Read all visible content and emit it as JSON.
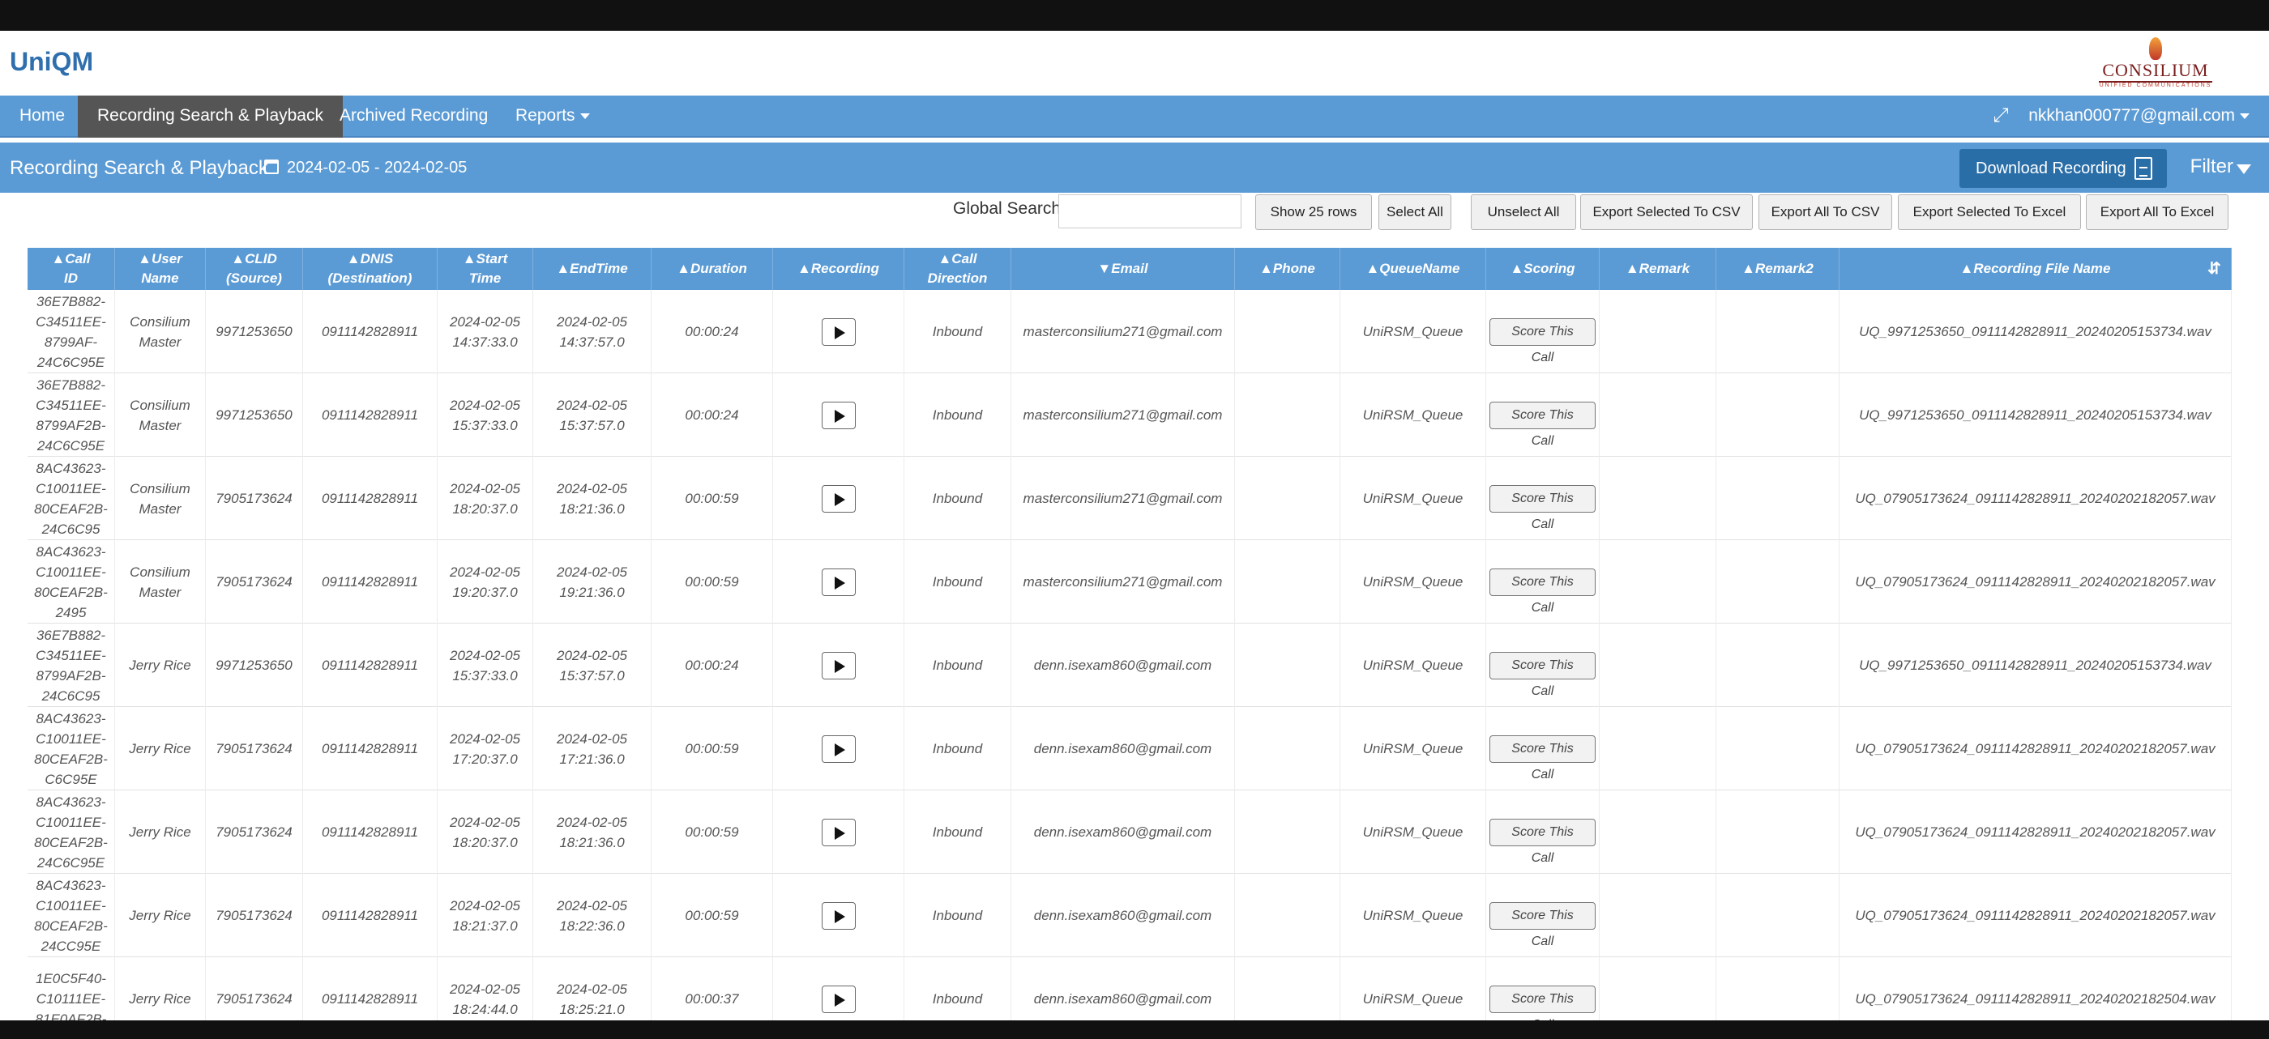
{
  "app": {
    "title": "UniQM",
    "logo_text": "CONSILIUM",
    "logo_subtext": "UNIFIED COMMUNICATIONS"
  },
  "nav": {
    "items": [
      {
        "label": "Home"
      },
      {
        "label": "Recording Search & Playback"
      },
      {
        "label": "Archived Recording"
      },
      {
        "label": "Reports"
      }
    ],
    "user": "nkkhan000777@gmail.com"
  },
  "page": {
    "title": "Recording Search & Playback",
    "date_range": "2024-02-05 - 2024-02-05",
    "download_label": "Download Recording",
    "filter_label": "Filter"
  },
  "toolbar": {
    "global_search_label": "Global Search",
    "global_search_value": "",
    "buttons": [
      "Show 25 rows",
      "Select All",
      "Unselect All",
      "Export Selected To CSV",
      "Export All To CSV",
      "Export Selected To Excel",
      "Export All To Excel"
    ]
  },
  "table": {
    "headers": [
      "▲Call\nID",
      "▲User\nName",
      "▲CLID\n(Source)",
      "▲DNIS\n(Destination)",
      "▲Start\nTime",
      "▲EndTime",
      "▲Duration",
      "▲Recording",
      "▲Call\nDirection",
      "▼Email",
      "▲Phone",
      "▲QueueName",
      "▲Scoring",
      "▲Remark",
      "▲Remark2",
      "▲Recording File Name"
    ],
    "score_label": "Score This Call",
    "rows": [
      {
        "call_id": "36E7B882-\nC34511EE-\n8799AF-\n24C6C95E",
        "user": "Consilium\nMaster",
        "clid": "9971253650",
        "dnis": "0911142828911",
        "start": "2024-02-05\n14:37:33.0",
        "end": "2024-02-05\n14:37:57.0",
        "duration": "00:00:24",
        "direction": "Inbound",
        "email": "masterconsilium271@gmail.com",
        "phone": "",
        "queue": "UniRSM_Queue",
        "remark": "",
        "remark2": "",
        "file": "UQ_9971253650_0911142828911_20240205153734.wav"
      },
      {
        "call_id": "36E7B882-\nC34511EE-\n8799AF2B-\n24C6C95E",
        "user": "Consilium\nMaster",
        "clid": "9971253650",
        "dnis": "0911142828911",
        "start": "2024-02-05\n15:37:33.0",
        "end": "2024-02-05\n15:37:57.0",
        "duration": "00:00:24",
        "direction": "Inbound",
        "email": "masterconsilium271@gmail.com",
        "phone": "",
        "queue": "UniRSM_Queue",
        "remark": "",
        "remark2": "",
        "file": "UQ_9971253650_0911142828911_20240205153734.wav"
      },
      {
        "call_id": "8AC43623-\nC10011EE-\n80CEAF2B-\n24C6C95",
        "user": "Consilium\nMaster",
        "clid": "7905173624",
        "dnis": "0911142828911",
        "start": "2024-02-05\n18:20:37.0",
        "end": "2024-02-05\n18:21:36.0",
        "duration": "00:00:59",
        "direction": "Inbound",
        "email": "masterconsilium271@gmail.com",
        "phone": "",
        "queue": "UniRSM_Queue",
        "remark": "",
        "remark2": "",
        "file": "UQ_07905173624_0911142828911_20240202182057.wav"
      },
      {
        "call_id": "8AC43623-\nC10011EE-\n80CEAF2B-\n2495",
        "user": "Consilium\nMaster",
        "clid": "7905173624",
        "dnis": "0911142828911",
        "start": "2024-02-05\n19:20:37.0",
        "end": "2024-02-05\n19:21:36.0",
        "duration": "00:00:59",
        "direction": "Inbound",
        "email": "masterconsilium271@gmail.com",
        "phone": "",
        "queue": "UniRSM_Queue",
        "remark": "",
        "remark2": "",
        "file": "UQ_07905173624_0911142828911_20240202182057.wav"
      },
      {
        "call_id": "36E7B882-\nC34511EE-\n8799AF2B-\n24C6C95",
        "user": "Jerry Rice",
        "clid": "9971253650",
        "dnis": "0911142828911",
        "start": "2024-02-05\n15:37:33.0",
        "end": "2024-02-05\n15:37:57.0",
        "duration": "00:00:24",
        "direction": "Inbound",
        "email": "denn.isexam860@gmail.com",
        "phone": "",
        "queue": "UniRSM_Queue",
        "remark": "",
        "remark2": "",
        "file": "UQ_9971253650_0911142828911_20240205153734.wav"
      },
      {
        "call_id": "8AC43623-\nC10011EE-\n80CEAF2B-\nC6C95E",
        "user": "Jerry Rice",
        "clid": "7905173624",
        "dnis": "0911142828911",
        "start": "2024-02-05\n17:20:37.0",
        "end": "2024-02-05\n17:21:36.0",
        "duration": "00:00:59",
        "direction": "Inbound",
        "email": "denn.isexam860@gmail.com",
        "phone": "",
        "queue": "UniRSM_Queue",
        "remark": "",
        "remark2": "",
        "file": "UQ_07905173624_0911142828911_20240202182057.wav"
      },
      {
        "call_id": "8AC43623-\nC10011EE-\n80CEAF2B-\n24C6C95E",
        "user": "Jerry Rice",
        "clid": "7905173624",
        "dnis": "0911142828911",
        "start": "2024-02-05\n18:20:37.0",
        "end": "2024-02-05\n18:21:36.0",
        "duration": "00:00:59",
        "direction": "Inbound",
        "email": "denn.isexam860@gmail.com",
        "phone": "",
        "queue": "UniRSM_Queue",
        "remark": "",
        "remark2": "",
        "file": "UQ_07905173624_0911142828911_20240202182057.wav"
      },
      {
        "call_id": "8AC43623-\nC10011EE-\n80CEAF2B-\n24CC95E",
        "user": "Jerry Rice",
        "clid": "7905173624",
        "dnis": "0911142828911",
        "start": "2024-02-05\n18:21:37.0",
        "end": "2024-02-05\n18:22:36.0",
        "duration": "00:00:59",
        "direction": "Inbound",
        "email": "denn.isexam860@gmail.com",
        "phone": "",
        "queue": "UniRSM_Queue",
        "remark": "",
        "remark2": "",
        "file": "UQ_07905173624_0911142828911_20240202182057.wav"
      },
      {
        "call_id": "1E0C5F40-\nC10111EE-\n81E0AF2B-",
        "user": "Jerry Rice",
        "clid": "7905173624",
        "dnis": "0911142828911",
        "start": "2024-02-05\n18:24:44.0",
        "end": "2024-02-05\n18:25:21.0",
        "duration": "00:00:37",
        "direction": "Inbound",
        "email": "denn.isexam860@gmail.com",
        "phone": "",
        "queue": "UniRSM_Queue",
        "remark": "",
        "remark2": "",
        "file": "UQ_07905173624_0911142828911_20240202182504.wav"
      }
    ]
  }
}
